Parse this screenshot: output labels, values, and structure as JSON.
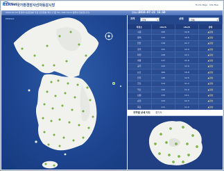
{
  "header": {
    "logo": "EERNet",
    "title": "국가환경방사선자동감시망",
    "links": [
      "Home Page",
      "Site Map"
    ]
  },
  "toolbar": {
    "notice": "2024.XX.XX 환경방사선준량률 자료 안전현황 확인 (기준 50~300 nSv/h 범위내 정상입니다)",
    "clock_label": "현재시각",
    "clock": "2016-07-21 15:50"
  },
  "map": {
    "sea_label": "EERNet"
  },
  "panel": {
    "filter": {
      "region_label": "지역",
      "region_value": "전국",
      "status_label": "상태",
      "status_value": "전체"
    },
    "table": {
      "columns": [
        "측정소",
        "nSv/h",
        "nSv/h",
        "상태"
      ],
      "rows": [
        {
          "site": "수원",
          "v1": "125",
          "v2": "12.8",
          "status": "▲정상"
        },
        {
          "site": "평택",
          "v1": "112",
          "v2": "10.5",
          "status": "▲정상"
        },
        {
          "site": "천안",
          "v1": "119",
          "v2": "11.7",
          "status": "▲정상"
        },
        {
          "site": "청주",
          "v1": "131",
          "v2": "12.4",
          "status": "▲정상"
        },
        {
          "site": "대전",
          "v1": "128",
          "v2": "12.1",
          "status": "▲정상"
        },
        {
          "site": "세종",
          "v1": "117",
          "v2": "11.6",
          "status": "▲정상"
        },
        {
          "site": "공주",
          "v1": "122",
          "v2": "12.0",
          "status": "▲정상"
        },
        {
          "site": "논산",
          "v1": "109",
          "v2": "10.9",
          "status": "▲정상"
        },
        {
          "site": "전주",
          "v1": "126",
          "v2": "12.5",
          "status": "▲정상"
        },
        {
          "site": "군산",
          "v1": "114",
          "v2": "11.2",
          "status": "▲정상"
        },
        {
          "site": "익산",
          "v1": "120",
          "v2": "11.9",
          "status": "▲정상"
        },
        {
          "site": "남원",
          "v1": "133",
          "v2": "13.1",
          "status": "▲정상"
        },
        {
          "site": "순천",
          "v1": "124",
          "v2": "12.3",
          "status": "▲정상"
        },
        {
          "site": "목포",
          "v1": "111",
          "v2": "11.0",
          "status": "▲정상"
        },
        {
          "site": "광양",
          "v1": "118",
          "v2": "11.8",
          "status": "▲정상"
        }
      ]
    },
    "inset": {
      "title": "지역별 상세 지도",
      "region": "경기도"
    }
  },
  "colors": {
    "sea": "#1e4691",
    "land": "#f2f3f0",
    "marker": "#7fbf3a",
    "toolbar": "#4b70b9"
  }
}
